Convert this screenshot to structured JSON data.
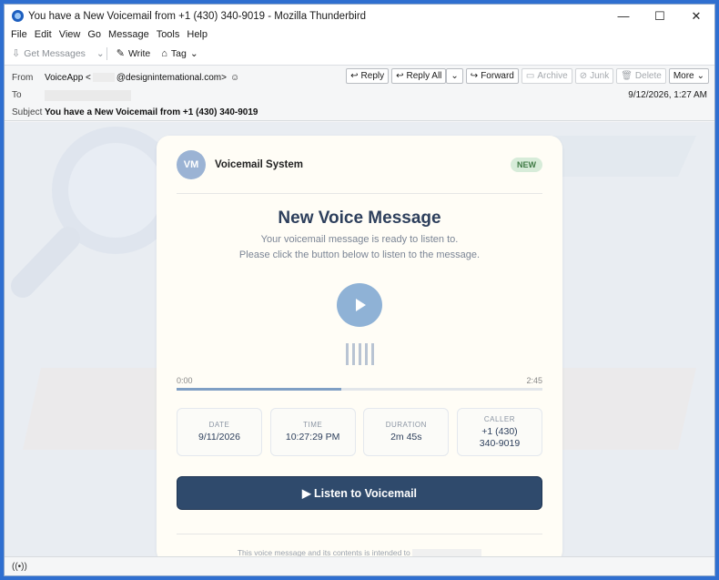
{
  "window": {
    "title": "You have a New Voicemail from +1 (430) 340-9019 - Mozilla Thunderbird",
    "minimize": "—",
    "maximize": "☐",
    "close": "✕"
  },
  "menu": [
    "File",
    "Edit",
    "View",
    "Go",
    "Message",
    "Tools",
    "Help"
  ],
  "toolbar": {
    "get_messages": "Get Messages",
    "write": "Write",
    "tag": "Tag"
  },
  "header": {
    "from_label": "From",
    "from_name": "VoiceApp <",
    "from_domain": "@designintemational.com>",
    "to_label": "To",
    "subject_label": "Subject",
    "subject": "You have a New Voicemail from +1 (430) 340-9019",
    "date": "9/12/2026, 1:27 AM",
    "buttons": {
      "reply": "Reply",
      "reply_all": "Reply All",
      "forward": "Forward",
      "archive": "Archive",
      "junk": "Junk",
      "delete": "Delete",
      "more": "More"
    }
  },
  "email": {
    "avatar_initials": "VM",
    "sender_name": "Voicemail System",
    "badge": "NEW",
    "title": "New Voice Message",
    "subtitle_line1": "Your voicemail message is ready to listen to.",
    "subtitle_line2": "Please click the button below to listen to the message.",
    "time_start": "0:00",
    "time_end": "2:45",
    "progress": 0.45,
    "info": [
      {
        "label": "DATE",
        "value": "9/11/2026"
      },
      {
        "label": "TIME",
        "value": "10:27:29 PM"
      },
      {
        "label": "DURATION",
        "value": "2m 45s"
      },
      {
        "label": "CALLER",
        "value": "+1 (430) 340-9019"
      }
    ],
    "cta": "▶ Listen to Voicemail",
    "footnote": "This voice message and its contents is intended to"
  },
  "colors": {
    "accent": "#2f4a6c",
    "badge_bg": "#d7ecd9",
    "play": "#8fb2d6"
  }
}
